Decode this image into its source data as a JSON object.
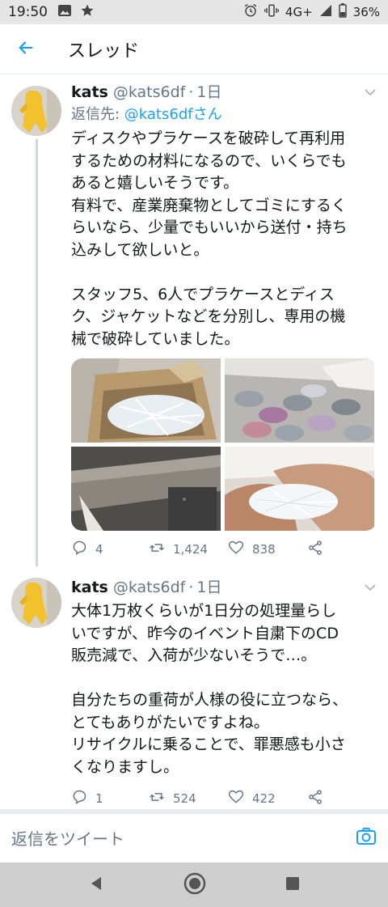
{
  "status_bar": {
    "time": "19:50",
    "network": "4G+",
    "battery": "36%"
  },
  "header": {
    "title": "スレッド"
  },
  "tweets": [
    {
      "name": "kats",
      "handle": "@kats6df",
      "dot": "·",
      "time": "1日",
      "reply_prefix": "返信先: ",
      "reply_mention": "@kats6dfさん",
      "text": "ディスクやプラケースを破砕して再利用\nするための材料になるので、いくらでも\nあると嬉しいそうです。\n有料で、産業廃棄物としてゴミにするく\nらいなら、少量でもいいから送付・持ち\n込みして欲しいと。\n\nスタッフ5、6人でプラケースとディス\nク、ジャケットなどを分別し、専用の機\n械で破砕していました。",
      "replies": "4",
      "retweets": "1,424",
      "likes": "838"
    },
    {
      "name": "kats",
      "handle": "@kats6df",
      "dot": "·",
      "time": "1日",
      "text": "大体1万枚くらいが1日分の処理量らし\nいですが、昨今のイベント自粛下のCD\n販売減で、入荷が少ないそうで…。\n\n自分たちの重荷が人様の役に立つなら、\nとてもありがたいですよね。\nリサイクルに乗ることで、罪悪感も小さ\nくなりますし。",
      "replies": "1",
      "retweets": "524",
      "likes": "422"
    }
  ],
  "reply_bar": {
    "placeholder": "返信をツイート"
  },
  "colors": {
    "accent": "#1da1f2",
    "secondary_text": "#657786",
    "thread_line": "#cfd9de"
  }
}
